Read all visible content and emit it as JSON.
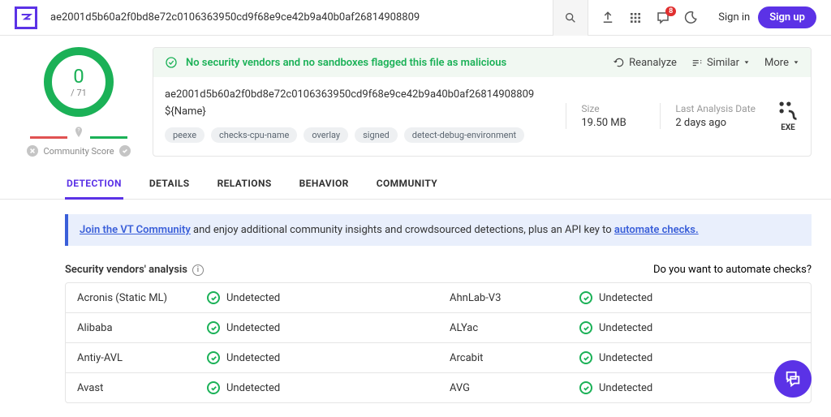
{
  "search_value": "ae2001d5b60a2f0bd8e72c0106363950cd9f68e9ce42b9a40b0af26814908809",
  "notif_badge": "8",
  "signin": "Sign in",
  "signup": "Sign up",
  "score": {
    "value": "0",
    "denom": "/ 71",
    "label": "Community Score"
  },
  "banner": {
    "text": "No security vendors and no sandboxes flagged this file as malicious",
    "reanalyze": "Reanalyze",
    "similar": "Similar",
    "more": "More"
  },
  "file": {
    "hash": "ae2001d5b60a2f0bd8e72c0106363950cd9f68e9ce42b9a40b0af26814908809",
    "name": "${Name}",
    "tags": [
      "peexe",
      "checks-cpu-name",
      "overlay",
      "signed",
      "detect-debug-environment"
    ],
    "size_lbl": "Size",
    "size_val": "19.50 MB",
    "date_lbl": "Last Analysis Date",
    "date_val": "2 days ago",
    "type": "EXE"
  },
  "tabs": [
    "DETECTION",
    "DETAILS",
    "RELATIONS",
    "BEHAVIOR",
    "COMMUNITY"
  ],
  "active_tab": 0,
  "promo": {
    "link1": "Join the VT Community",
    "mid": " and enjoy additional community insights and crowdsourced detections, plus an API key to ",
    "link2": "automate checks."
  },
  "vendors_title": "Security vendors' analysis",
  "automate_q": "Do you want to automate checks?",
  "undetected": "Undetected",
  "vendors": [
    [
      "Acronis (Static ML)",
      "AhnLab-V3"
    ],
    [
      "Alibaba",
      "ALYac"
    ],
    [
      "Antiy-AVL",
      "Arcabit"
    ],
    [
      "Avast",
      "AVG"
    ]
  ]
}
